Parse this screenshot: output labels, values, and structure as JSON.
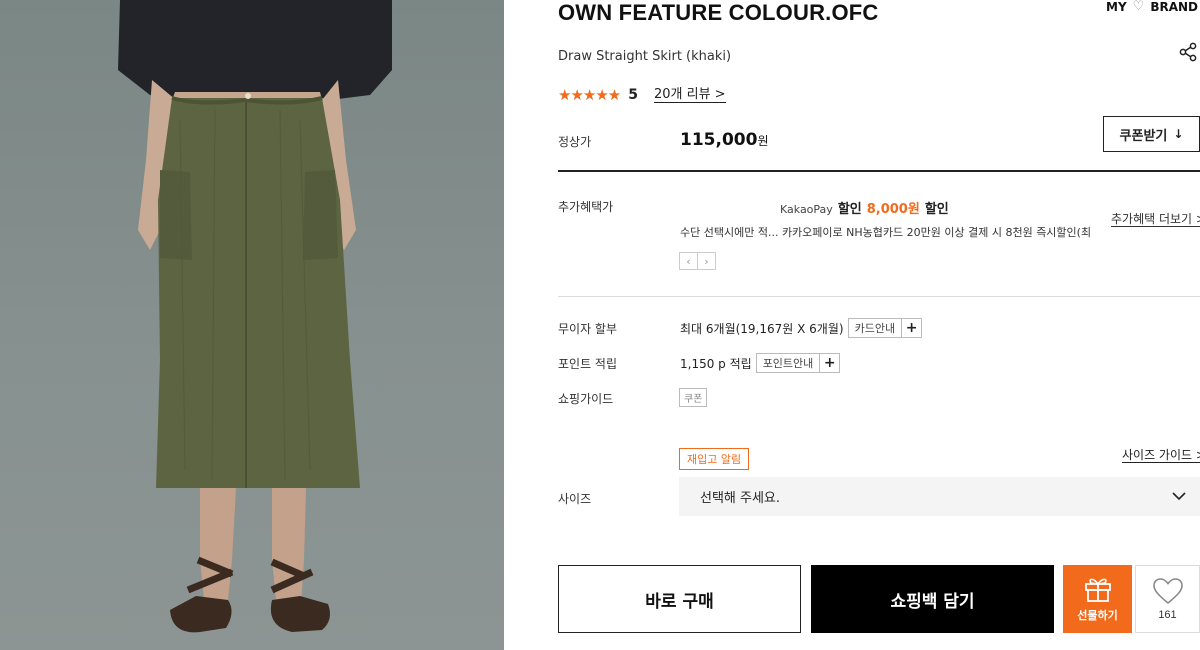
{
  "product": {
    "brand": "OWN FEATURE COLOUR.OFC",
    "name": "Draw Straight Skirt (khaki)",
    "rating_stars": "★★★★★",
    "rating_score": "5",
    "review_link": "20개 리뷰 >"
  },
  "topnav": {
    "my": "MY",
    "heart": "♡",
    "brand": "BRAND"
  },
  "price": {
    "label": "정상가",
    "amount": "115,000",
    "unit": "원",
    "coupon_button": "쿠폰받기",
    "coupon_icon": "↓"
  },
  "benefits": {
    "label": "추가혜택가",
    "kakao_pay": "KakaoPay",
    "discount_word": "할인",
    "discount_amount": "8,000원",
    "discount_suffix": "할인",
    "more_link": "추가혜택 더보기 >",
    "promo_text": "수단 선택시에만 적... 카카오페이로 NH농협카드 20만원 이상 결제 시 8천원 즉시할인(최",
    "prev": "‹",
    "next": "›"
  },
  "installment": {
    "label": "무이자 할부",
    "value": "최대 6개월(19,167원 X 6개월)",
    "tag": "카드안내",
    "plus": "+"
  },
  "points": {
    "label": "포인트 적립",
    "value": "1,150 p 적립",
    "tag": "포인트안내",
    "plus": "+"
  },
  "shopping_guide": {
    "label": "쇼핑가이드",
    "tag": "쿠폰"
  },
  "size": {
    "restock": "재입고 알림",
    "guide_link": "사이즈 가이드 >",
    "label": "사이즈",
    "select_placeholder": "선택해 주세요."
  },
  "actions": {
    "buy_now": "바로 구매",
    "add_to_bag": "쇼핑백 담기",
    "gift": "선물하기",
    "like_count": "161"
  },
  "colors": {
    "accent": "#f26b1d",
    "skirt": "#5d6442",
    "shirt": "#22242a",
    "background": "#87918f"
  },
  "icons": [
    "heart-icon",
    "share-icon",
    "star-icon",
    "download-icon",
    "chevron-down-icon",
    "gift-icon",
    "like-heart-icon"
  ]
}
